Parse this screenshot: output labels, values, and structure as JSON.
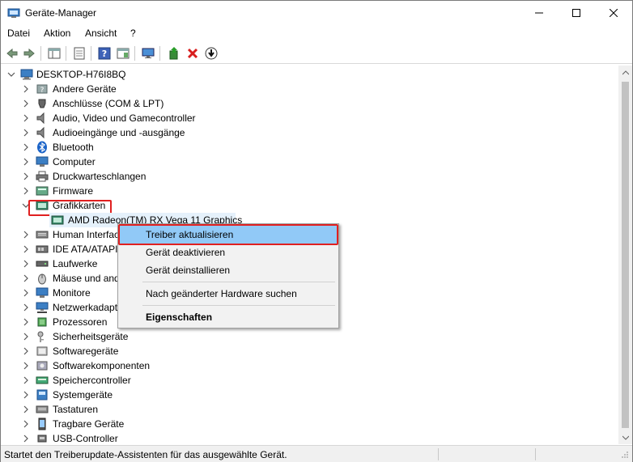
{
  "window": {
    "title": "Geräte-Manager",
    "controls": {
      "minimize": "—",
      "maximize": "☐",
      "close": "✕"
    }
  },
  "menubar": [
    "Datei",
    "Aktion",
    "Ansicht",
    "?"
  ],
  "toolbar": [
    "back-icon",
    "forward-icon",
    "properties-pane-icon",
    "console-tree-icon",
    "help-icon",
    "show-hide-icon",
    "monitor-scan-icon",
    "update-driver-icon",
    "uninstall-icon",
    "download-icon"
  ],
  "tree": {
    "root": "DESKTOP-H76I8BQ",
    "categories": [
      "Andere Geräte",
      "Anschlüsse (COM & LPT)",
      "Audio, Video und Gamecontroller",
      "Audioeingänge und -ausgänge",
      "Bluetooth",
      "Computer",
      "Druckwarteschlangen",
      "Firmware",
      "Grafikkarten",
      "AMD Radeon(TM) RX Vega 11 Graphics",
      "Human Interfac",
      "IDE ATA/ATAPI-",
      "Laufwerke",
      "Mäuse und and",
      "Monitore",
      "Netzwerkadapt",
      "Prozessoren",
      "Sicherheitsgeräte",
      "Softwaregeräte",
      "Softwarekomponenten",
      "Speichercontroller",
      "Systemgeräte",
      "Tastaturen",
      "Tragbare Geräte",
      "USB-Controller"
    ]
  },
  "context_menu": {
    "items": [
      "Treiber aktualisieren",
      "Gerät deaktivieren",
      "Gerät deinstallieren",
      "Nach geänderter Hardware suchen",
      "Eigenschaften"
    ]
  },
  "statusbar": {
    "text": "Startet den Treiberupdate-Assistenten für das ausgewählte Gerät."
  },
  "colors": {
    "highlight_border": "#e02020",
    "menu_active": "#91c9f7",
    "selection": "#e5f1fb"
  }
}
